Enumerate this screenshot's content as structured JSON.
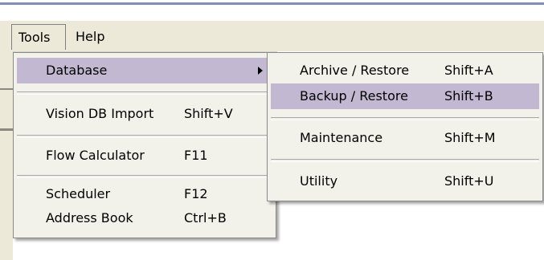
{
  "menubar": {
    "tools": "Tools",
    "help": "Help"
  },
  "tools_menu": {
    "items": [
      {
        "label": "Database",
        "shortcut": ""
      },
      {
        "label": "Vision DB Import",
        "shortcut": "Shift+V"
      },
      {
        "label": "Flow Calculator",
        "shortcut": "F11"
      },
      {
        "label": "Scheduler",
        "shortcut": "F12"
      },
      {
        "label": "Address Book",
        "shortcut": "Ctrl+B"
      }
    ]
  },
  "database_menu": {
    "items": [
      {
        "label": "Archive / Restore",
        "shortcut": "Shift+A"
      },
      {
        "label": "Backup / Restore",
        "shortcut": "Shift+B"
      },
      {
        "label": "Maintenance",
        "shortcut": "Shift+M"
      },
      {
        "label": "Utility",
        "shortcut": "Shift+U"
      }
    ]
  },
  "colors": {
    "menu_bg": "#f2f1ea",
    "menubar_bg": "#ece9d8",
    "selection": "#c2b8d1"
  },
  "icons": [
    "submenu-arrow-icon"
  ]
}
